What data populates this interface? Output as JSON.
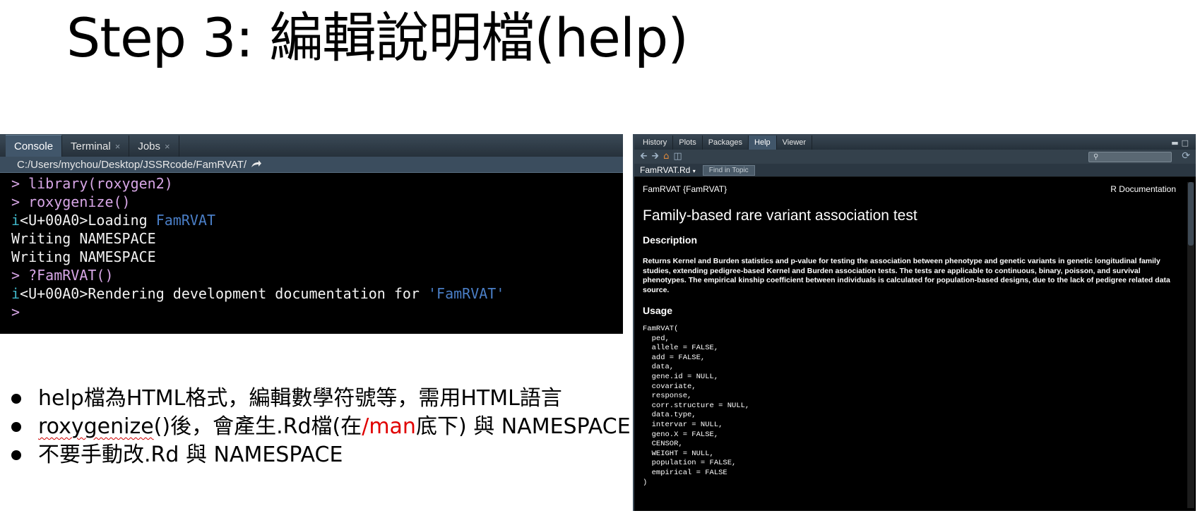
{
  "slide": {
    "title": "Step 3: 編輯說明檔(help)"
  },
  "console": {
    "tabs": [
      {
        "label": "Console"
      },
      {
        "label": "Terminal",
        "close": "×"
      },
      {
        "label": "Jobs",
        "close": "×"
      }
    ],
    "path": "C:/Users/mychou/Desktop/JSSRcode/FamRVAT/",
    "path_icon": "arrow-icon",
    "lines": {
      "l1_prompt": ">",
      "l1_cmd": "library(roxygen2)",
      "l2_prompt": ">",
      "l2_cmd": "roxygenize()",
      "l3_i": "i",
      "l3_text": "<U+00A0>Loading ",
      "l3_pkg": "FamRVAT",
      "l4": "Writing NAMESPACE",
      "l5": "Writing NAMESPACE",
      "l6_prompt": ">",
      "l6_cmd": "?FamRVAT()",
      "l7_i": "i",
      "l7_text": "<U+00A0>Rendering development documentation for ",
      "l7_pkg": "'FamRVAT'",
      "l8_prompt": ">"
    },
    "colors": {
      "prompt": "#d7a6e6",
      "info": "#3fb7c9",
      "pkg": "#4a7ec6"
    }
  },
  "bullets": {
    "b1": "help檔為HTML格式，編輯數學符號等，需用HTML語言",
    "b2_a": "roxygenize",
    "b2_b": "()後，會產生.Rd檔(在",
    "b2_c": "/man",
    "b2_d": "底下) 與 NAMESPACE",
    "b3": "不要手動改.Rd 與 NAMESPACE"
  },
  "help_panel": {
    "tabs": [
      {
        "label": "History"
      },
      {
        "label": "Plots"
      },
      {
        "label": "Packages"
      },
      {
        "label": "Help"
      },
      {
        "label": "Viewer"
      }
    ],
    "toolbar_icons": [
      "back-arrow-icon",
      "forward-arrow-icon",
      "home-icon",
      "popout-icon",
      "search-icon",
      "refresh-icon"
    ],
    "topic_file": "FamRVAT.Rd",
    "find_in_topic": "Find in Topic",
    "doc": {
      "header_left": "FamRVAT {FamRVAT}",
      "header_right": "R Documentation",
      "title": "Family-based rare variant association test",
      "desc_heading": "Description",
      "description": "Returns Kernel and Burden statistics and p-value for testing the association between phenotype and genetic variants in genetic longitudinal family studies, extending pedigree-based Kernel and Burden association tests. The tests are applicable to continuous, binary, poisson, and survival phenotypes. The empirical kinship coefficient between individuals is calculated for population-based designs, due to the lack of pedigree related data source.",
      "usage_heading": "Usage",
      "usage": "FamRVAT(\n  ped,\n  allele = FALSE,\n  add = FALSE,\n  data,\n  gene.id = NULL,\n  covariate,\n  response,\n  corr.structure = NULL,\n  data.type,\n  intervar = NULL,\n  geno.X = FALSE,\n  CENSOR,\n  WEIGHT = NULL,\n  population = FALSE,\n  empirical = FALSE\n)"
    }
  }
}
